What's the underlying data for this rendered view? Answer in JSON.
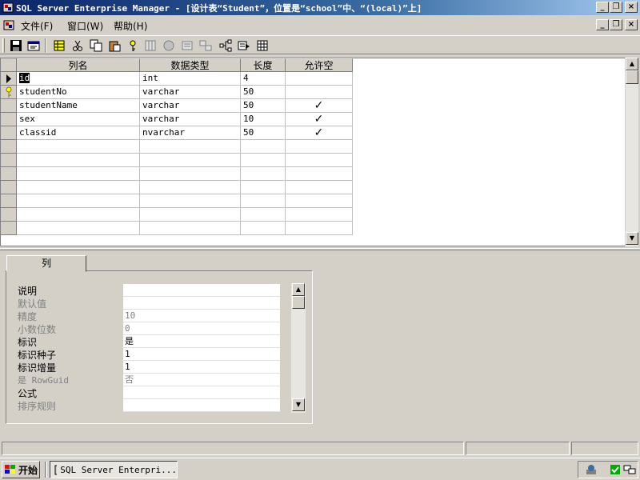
{
  "window": {
    "title": "SQL Server Enterprise Manager - [设计表“Student”，位置是“school”中、“(local)”上]"
  },
  "menu": {
    "items": [
      "文件(F)",
      "窗口(W)",
      "帮助(H)"
    ]
  },
  "toolbar": {
    "buttons": [
      "save-icon",
      "properties-icon",
      "table-props-icon",
      "cut-icon",
      "copy-icon",
      "paste-icon",
      "key-icon",
      "insert-column-icon",
      "delete-column-icon",
      "manage-indexes-icon",
      "manage-relationships-icon",
      "manage-constraints-icon",
      "manage-triggers-icon",
      "script-icon"
    ]
  },
  "grid": {
    "headers": [
      "列名",
      "数据类型",
      "长度",
      "允许空"
    ],
    "rows": [
      {
        "name": "id",
        "type": "int",
        "length": "4",
        "allow_null": ""
      },
      {
        "name": "studentNo",
        "type": "varchar",
        "length": "50",
        "allow_null": ""
      },
      {
        "name": "studentName",
        "type": "varchar",
        "length": "50",
        "allow_null": "✓"
      },
      {
        "name": "sex",
        "type": "varchar",
        "length": "10",
        "allow_null": "✓"
      },
      {
        "name": "classid",
        "type": "nvarchar",
        "length": "50",
        "allow_null": "✓"
      }
    ]
  },
  "properties": {
    "tab": "列",
    "items": [
      {
        "label": "说明",
        "value": "",
        "disabled": false
      },
      {
        "label": "默认值",
        "value": "",
        "disabled": true
      },
      {
        "label": "精度",
        "value": "10",
        "disabled": true
      },
      {
        "label": "小数位数",
        "value": "0",
        "disabled": true
      },
      {
        "label": "标识",
        "value": "是",
        "disabled": false
      },
      {
        "label": "标识种子",
        "value": "1",
        "disabled": false
      },
      {
        "label": "标识增量",
        "value": "1",
        "disabled": false
      },
      {
        "label": "是 RowGuid",
        "value": "否",
        "disabled": true
      },
      {
        "label": "公式",
        "value": "",
        "disabled": false
      },
      {
        "label": "排序规则",
        "value": "",
        "disabled": true
      }
    ]
  },
  "taskbar": {
    "start_label": "开始",
    "task_label": "SQL Server Enterpri..."
  }
}
